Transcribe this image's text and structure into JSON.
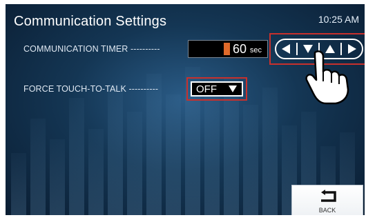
{
  "header": {
    "title": "Communication Settings",
    "time": "10:25 AM"
  },
  "settings": {
    "timer": {
      "label": "COMMUNICATION TIMER",
      "value": "60",
      "unit": "sec"
    },
    "force_talk": {
      "label": "FORCE TOUCH-TO-TALK",
      "value": "OFF"
    }
  },
  "navigation": {
    "icons": [
      "left-arrow",
      "down-arrow",
      "up-arrow",
      "right-arrow"
    ]
  },
  "footer": {
    "back_label": "BACK"
  },
  "colors": {
    "highlight": "#c9302c",
    "cursor": "#e06a2a",
    "background": "#143654"
  }
}
